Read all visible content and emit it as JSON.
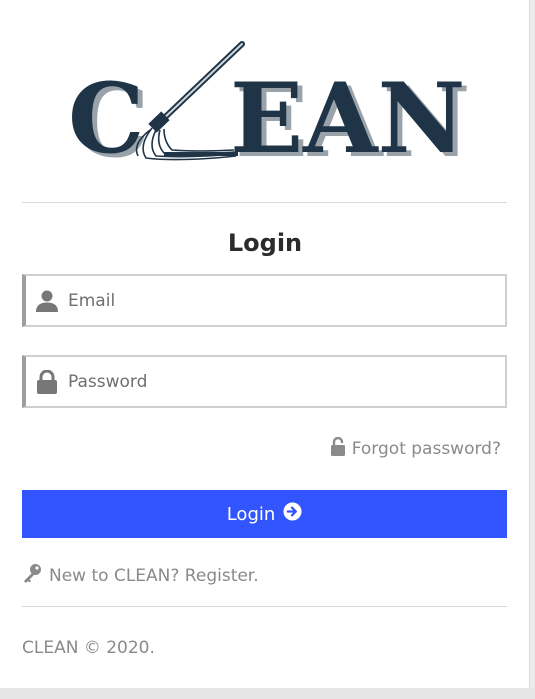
{
  "brand": {
    "logo_text": "CLEAN",
    "colors": {
      "navy": "#1f3447",
      "shadow": "#9aa3aa"
    }
  },
  "form": {
    "title": "Login",
    "email": {
      "placeholder": "Email",
      "value": "",
      "icon": "user-icon"
    },
    "password": {
      "placeholder": "Password",
      "value": "",
      "icon": "lock-icon"
    },
    "forgot_label": "Forgot password?",
    "forgot_icon": "unlock-icon",
    "submit_label": "Login",
    "submit_icon": "arrow-circle-right-icon",
    "register_label": "New to CLEAN? Register.",
    "register_icon": "key-icon"
  },
  "footer": {
    "text": "CLEAN © 2020."
  },
  "theme": {
    "primary": "#3355ff",
    "muted_text": "#8a8a8a"
  }
}
